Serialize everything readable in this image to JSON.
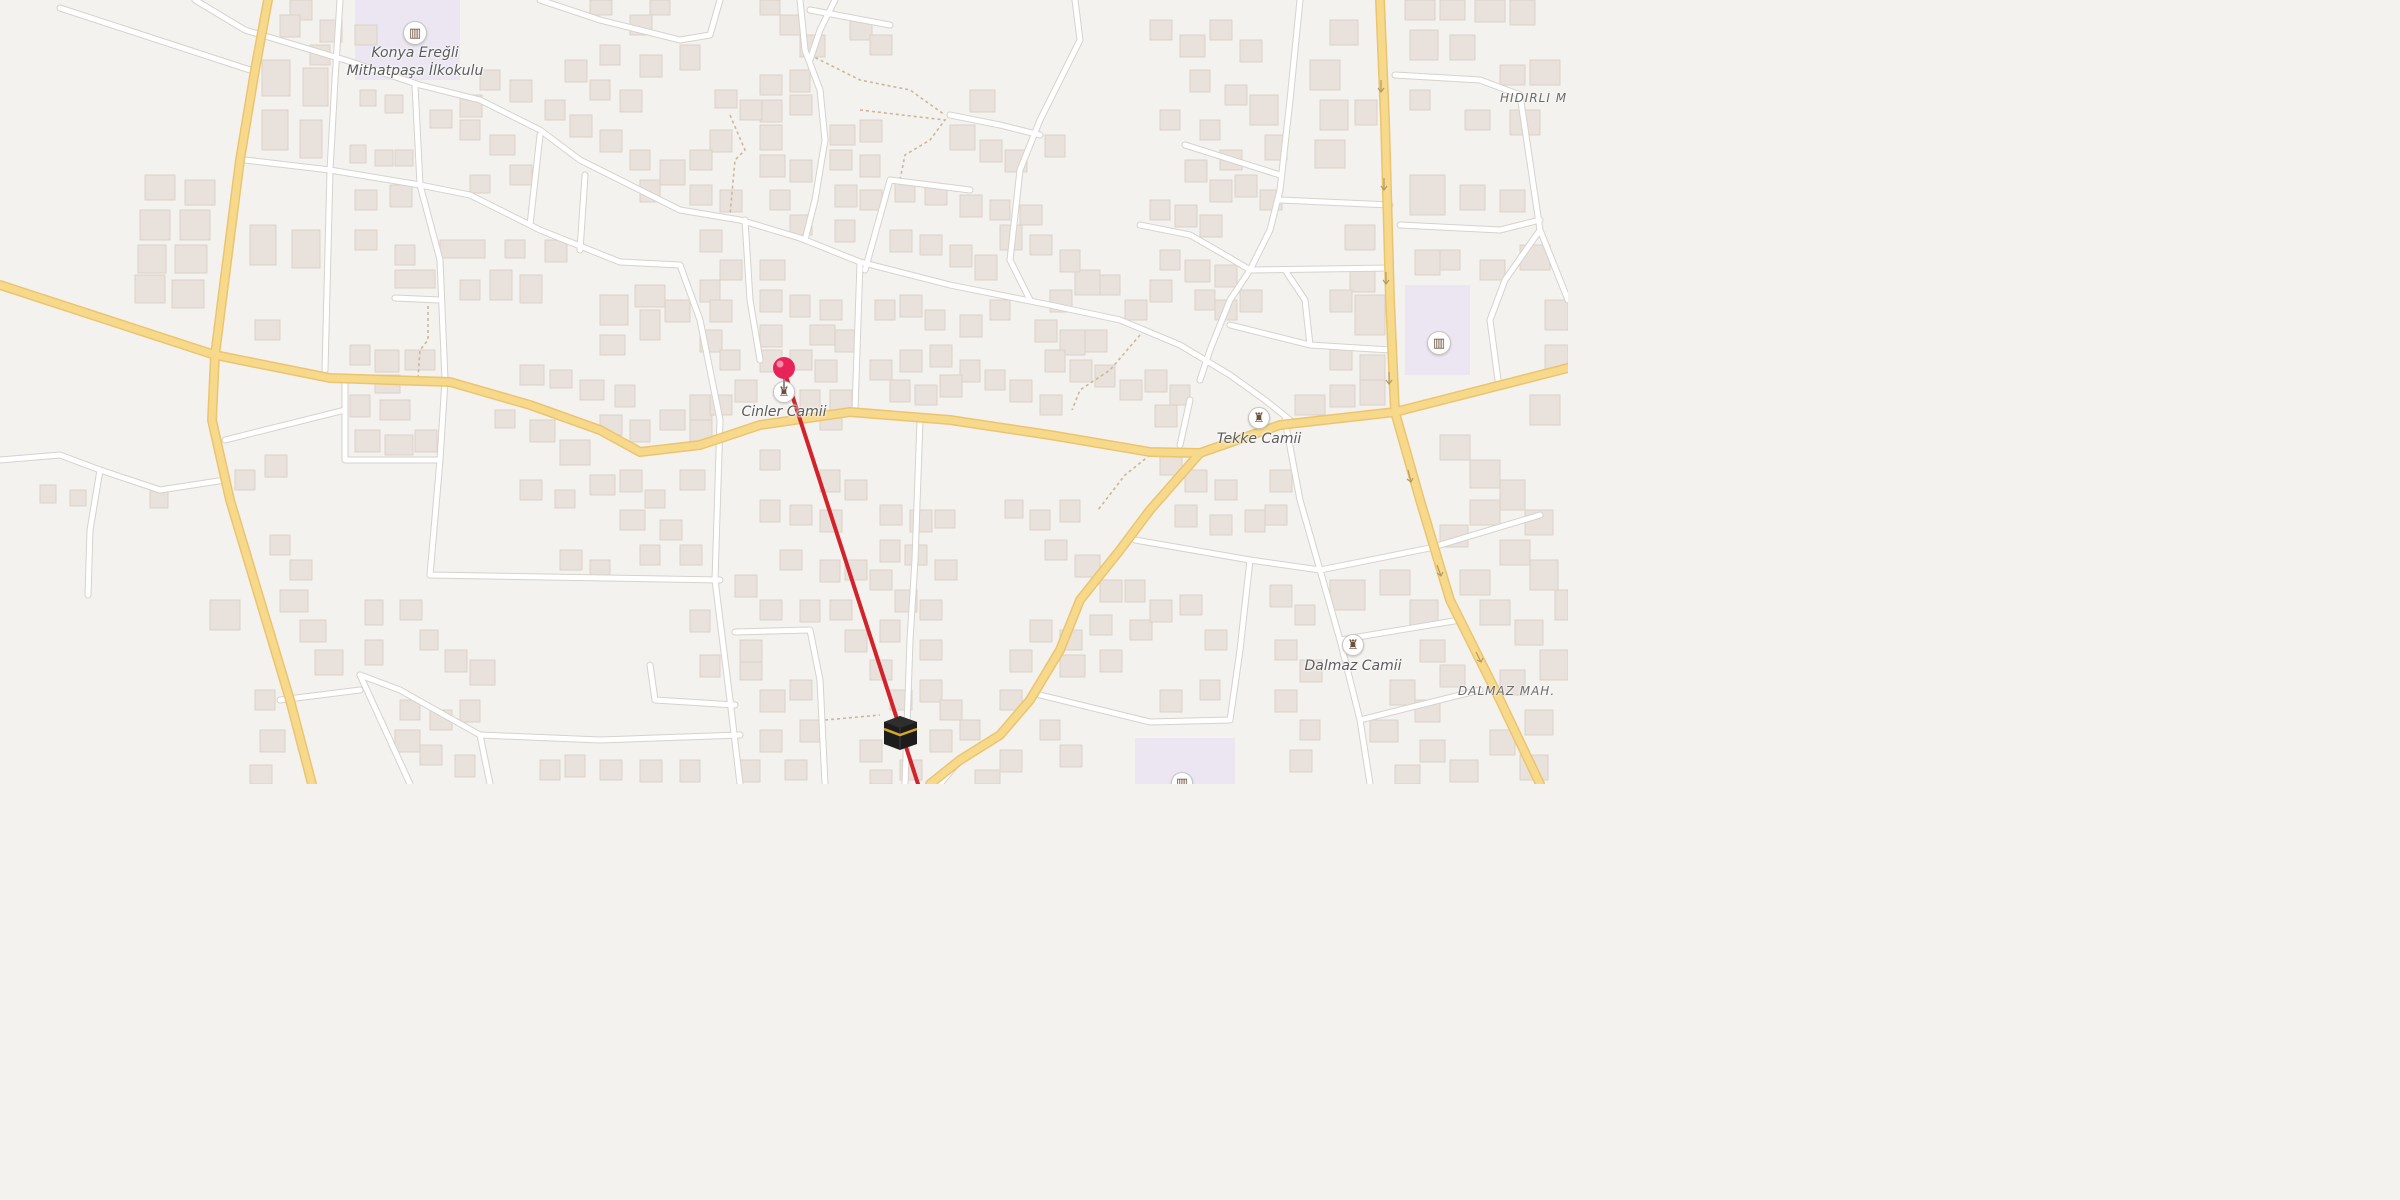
{
  "colors": {
    "background": "#f4f2ef",
    "building": "#e9e1db",
    "building_edge": "#d9cfc7",
    "minor_road": "#ffffff",
    "major_road": "#f7d98c",
    "major_road_casing": "#ecc46f",
    "path": "#c9b79a",
    "school_area": "#ebe6f2",
    "route_line": "#d2232a",
    "pin": "#e8235a"
  },
  "places": {
    "school": {
      "name_line1": "Konya Ereğli",
      "name_line2": "Mithatpaşa İlkokulu",
      "icon": "school-icon"
    },
    "cinler": {
      "name": "Cinler Camii",
      "icon": "mosque-icon"
    },
    "tekke": {
      "name": "Tekke Camii",
      "icon": "mosque-icon"
    },
    "dalmaz": {
      "name": "Dalmaz Camii",
      "icon": "mosque-icon"
    },
    "east_school": {
      "icon": "school-icon"
    },
    "south_school": {
      "icon": "school-icon"
    }
  },
  "areas": {
    "hidirli": "HIDIRLI M",
    "dalmaz": "DALMAZ MAH."
  },
  "markers": {
    "pin": {
      "name": "location-pin-icon"
    },
    "kaaba": {
      "name": "kaaba-icon"
    }
  },
  "route": {
    "label": "qibla-direction-line"
  }
}
